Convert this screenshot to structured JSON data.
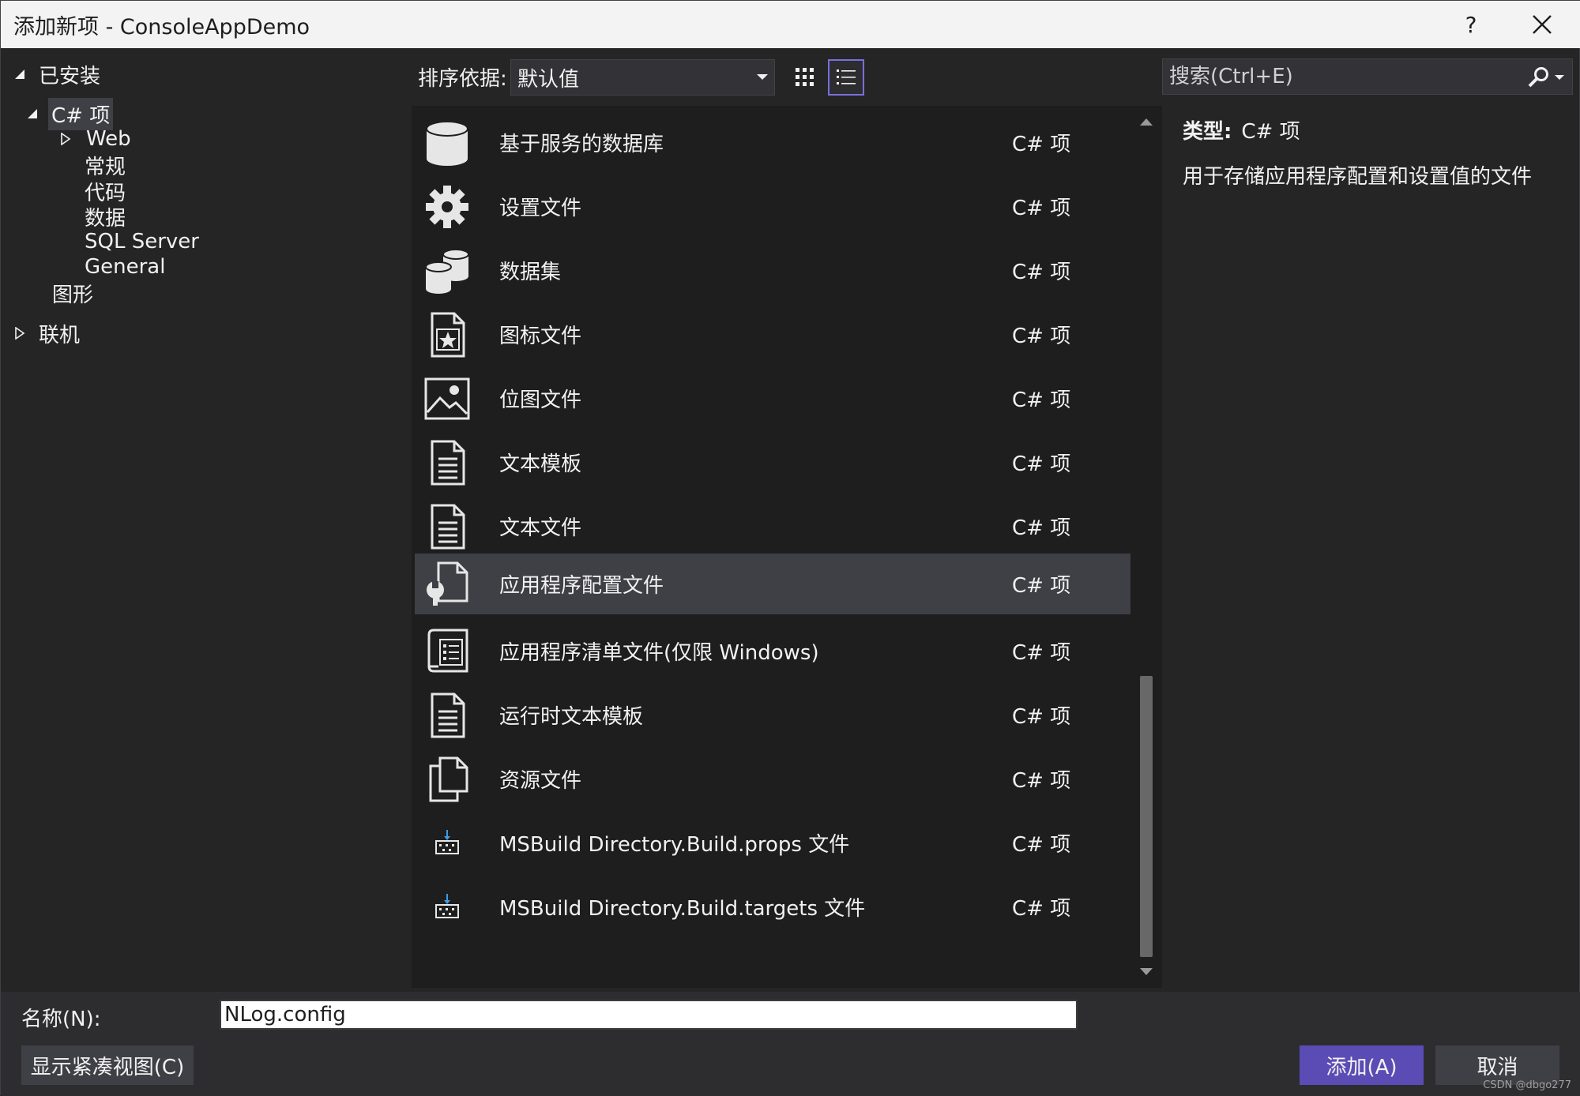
{
  "window": {
    "title": "添加新项 - ConsoleAppDemo",
    "help_label": "?"
  },
  "tree": {
    "installed": "已安装",
    "csharp": "C# 项",
    "web": "Web",
    "general_zh": "常规",
    "code": "代码",
    "data": "数据",
    "sql_server": "SQL Server",
    "general": "General",
    "graphics": "图形",
    "online": "联机"
  },
  "sort": {
    "label": "排序依据:",
    "value": "默认值"
  },
  "search": {
    "placeholder": "搜索(Ctrl+E)"
  },
  "templates": [
    {
      "name": "基于服务的数据库",
      "type": "C# 项",
      "icon": "database-icon"
    },
    {
      "name": "设置文件",
      "type": "C# 项",
      "icon": "gear-icon"
    },
    {
      "name": "数据集",
      "type": "C# 项",
      "icon": "dataset-icon"
    },
    {
      "name": "图标文件",
      "type": "C# 项",
      "icon": "icon-file-icon"
    },
    {
      "name": "位图文件",
      "type": "C# 项",
      "icon": "bitmap-icon"
    },
    {
      "name": "文本模板",
      "type": "C# 项",
      "icon": "text-template-icon"
    },
    {
      "name": "文本文件",
      "type": "C# 项",
      "icon": "text-file-icon"
    },
    {
      "name": "应用程序配置文件",
      "type": "C# 项",
      "icon": "config-file-icon",
      "selected": true
    },
    {
      "name": "应用程序清单文件(仅限 Windows)",
      "type": "C# 项",
      "icon": "manifest-icon"
    },
    {
      "name": "运行时文本模板",
      "type": "C# 项",
      "icon": "runtime-template-icon"
    },
    {
      "name": "资源文件",
      "type": "C# 项",
      "icon": "resource-file-icon"
    },
    {
      "name": "MSBuild Directory.Build.props 文件",
      "type": "C# 项",
      "icon": "msbuild-icon"
    },
    {
      "name": "MSBuild Directory.Build.targets 文件",
      "type": "C# 项",
      "icon": "msbuild-icon"
    }
  ],
  "details": {
    "type_key": "类型:",
    "type_value": "C# 项",
    "description": "用于存储应用程序配置和设置值的文件"
  },
  "bottom": {
    "name_label": "名称(N):",
    "name_value": "NLog.config",
    "compact_view": "显示紧凑视图(C)",
    "add": "添加(A)",
    "cancel": "取消"
  },
  "watermark": "CSDN @dbgo277",
  "colors": {
    "background": "#252526",
    "list_background": "#1e1e1e",
    "selected_row": "#3f3f46",
    "primary_button": "#5b4bb5",
    "active_view_border": "#7a6fdb"
  }
}
